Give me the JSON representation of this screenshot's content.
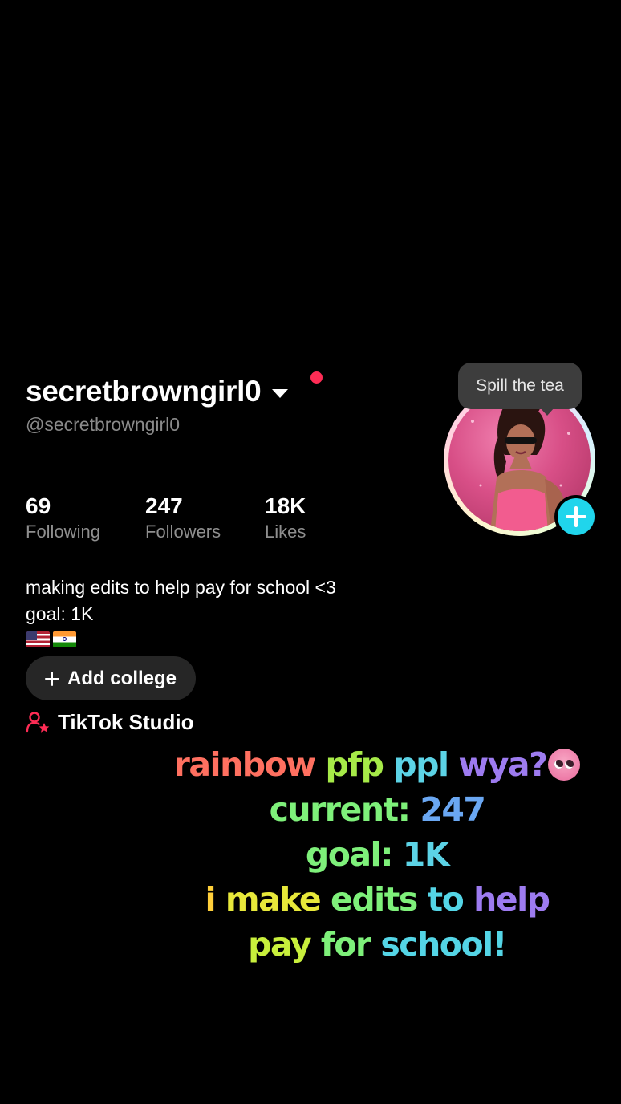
{
  "profile": {
    "display_name": "secretbrowngirl0",
    "handle": "@secretbrowngirl0",
    "tooltip": "Spill the tea"
  },
  "stats": {
    "following": {
      "value": "69",
      "label": "Following"
    },
    "followers": {
      "value": "247",
      "label": "Followers"
    },
    "likes": {
      "value": "18K",
      "label": "Likes"
    }
  },
  "bio": {
    "line1": "making edits to help pay for school <3",
    "line2": "goal: 1K",
    "flags": [
      "us-flag",
      "india-flag"
    ]
  },
  "buttons": {
    "add_college": "Add college",
    "studio": "TikTok Studio"
  },
  "overlay_text": {
    "line1_words": [
      "rainbow",
      "pfp",
      "ppl",
      "wya?"
    ],
    "line1_emoji": "pleading-face-emoji",
    "line2_label": "current:",
    "line2_value": "247",
    "line3_label": "goal:",
    "line3_value": "1K",
    "line4_words": [
      "i",
      "make",
      "edits",
      "to",
      "help"
    ],
    "line5_words": [
      "pay",
      "for",
      "school!"
    ]
  },
  "colors": {
    "background": "#000000",
    "notification_dot": "#fe2c55",
    "add_avatar": "#20d5ec",
    "studio_icon": "#fe2c55",
    "overlay_red": "#ff6b5e",
    "overlay_orange": "#ffb347",
    "overlay_yellow": "#e7e83a",
    "overlay_green": "#7ef07a",
    "overlay_cyan": "#54d5e6",
    "overlay_blue": "#6aa7f2",
    "overlay_purple": "#9d7bf0"
  }
}
